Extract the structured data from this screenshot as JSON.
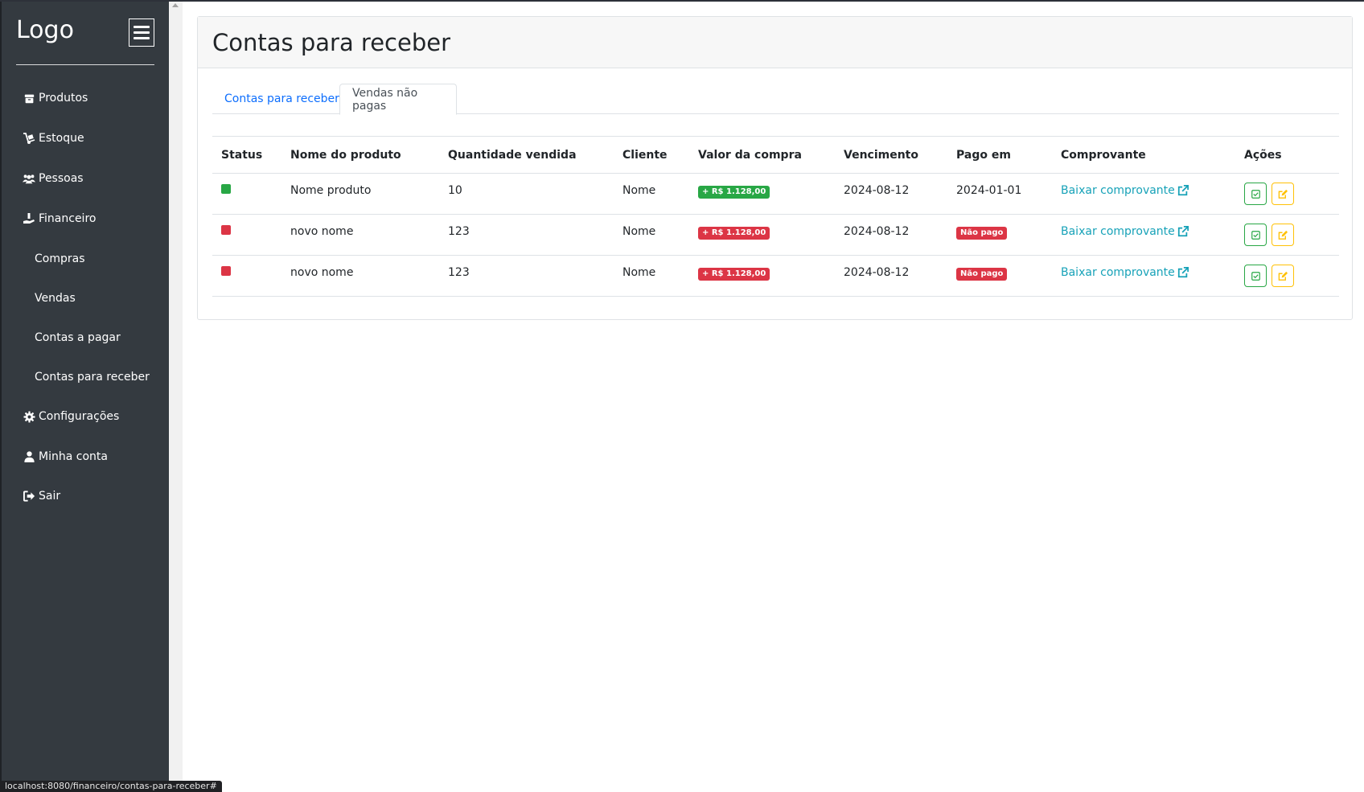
{
  "sidebar": {
    "brand": "Logo",
    "items": [
      {
        "label": "Produtos",
        "icon": "box-icon"
      },
      {
        "label": "Estoque",
        "icon": "dolly-icon"
      },
      {
        "label": "Pessoas",
        "icon": "users-icon"
      },
      {
        "label": "Financeiro",
        "icon": "hand-holding-dollar-icon"
      },
      {
        "label": "Compras"
      },
      {
        "label": "Vendas"
      },
      {
        "label": "Contas a pagar"
      },
      {
        "label": "Contas para receber"
      },
      {
        "label": "Configurações",
        "icon": "gear-icon"
      },
      {
        "label": "Minha conta",
        "icon": "user-icon"
      },
      {
        "label": "Sair",
        "icon": "sign-out-icon"
      }
    ]
  },
  "page": {
    "title": "Contas para receber",
    "tabs": [
      {
        "label": "Contas para receber",
        "active": false
      },
      {
        "label": "Vendas não pagas",
        "active": true
      }
    ]
  },
  "table": {
    "headers": [
      "Status",
      "Nome do produto",
      "Quantidade vendida",
      "Cliente",
      "Valor da compra",
      "Vencimento",
      "Pago em",
      "Comprovante",
      "Ações"
    ],
    "rows": [
      {
        "status": "paid",
        "product": "Nome produto",
        "quantity": "10",
        "client": "Nome",
        "value": "+ R$ 1.128,00",
        "due": "2024-08-12",
        "paid_on": "2024-01-01",
        "receipt": "Baixar comprovante"
      },
      {
        "status": "unpaid",
        "product": "novo nome",
        "quantity": "123",
        "client": "Nome",
        "value": "+ R$ 1.128,00",
        "due": "2024-08-12",
        "paid_on": "Não pago",
        "receipt": "Baixar comprovante"
      },
      {
        "status": "unpaid",
        "product": "novo nome",
        "quantity": "123",
        "client": "Nome",
        "value": "+ R$ 1.128,00",
        "due": "2024-08-12",
        "paid_on": "Não pago",
        "receipt": "Baixar comprovante"
      }
    ]
  },
  "statusbar": "localhost:8080/financeiro/contas-para-receber#",
  "colors": {
    "sidebar_bg": "#343a40",
    "success": "#28a745",
    "danger": "#dc3545",
    "warning": "#ffc107",
    "info": "#17a2b8",
    "primary": "#0d6efd"
  }
}
